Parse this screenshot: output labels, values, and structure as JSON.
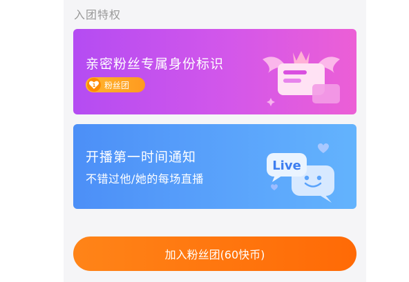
{
  "section": {
    "title": "入团特权"
  },
  "privileges": [
    {
      "title": "亲密粉丝专属身份标识",
      "badge": {
        "level": "1",
        "label": "粉丝团",
        "icon": "heart-level-badge-icon"
      },
      "illustration": "winged-nameplate-crown-icon"
    },
    {
      "title": "开播第一时间通知",
      "subtitle": "不错过他/她的每场直播",
      "illustration": {
        "icon": "live-chat-bubble-icon",
        "text": "Live"
      }
    }
  ],
  "join_button": {
    "label": "加入粉丝团(60快币)"
  },
  "colors": {
    "identity_gradient_start": "#b44cf2",
    "identity_gradient_end": "#ec5fd6",
    "notify_gradient_start": "#4c8ff7",
    "notify_gradient_end": "#63b3fd",
    "button_start": "#ff8418",
    "button_end": "#ff6a06",
    "badge": "#ffa826"
  }
}
